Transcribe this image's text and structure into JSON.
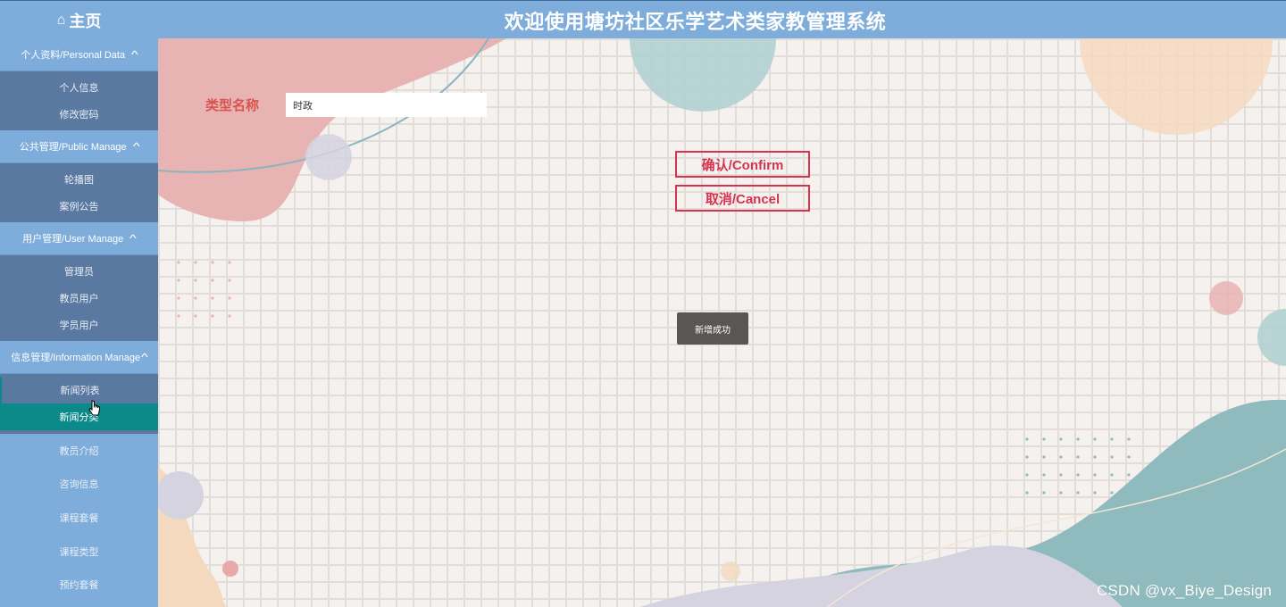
{
  "header": {
    "home_icon": "home-icon",
    "home_label": "主页",
    "title": "欢迎使用塘坊社区乐学艺术类家教管理系统"
  },
  "sidebar": {
    "groups": [
      {
        "label": "个人资料/Personal Data",
        "items": [
          "个人信息",
          "修改密码"
        ]
      },
      {
        "label": "公共管理/Public Manage",
        "items": [
          "轮播图",
          "案例公告"
        ]
      },
      {
        "label": "用户管理/User Manage",
        "items": [
          "管理员",
          "教员用户",
          "学员用户"
        ]
      },
      {
        "label": "信息管理/Information Manage",
        "items": [
          "新闻列表",
          "新闻分类"
        ]
      }
    ],
    "active_item": "新闻分类",
    "hovered_item": "新闻列表",
    "plain_items": [
      "教员介绍",
      "咨询信息",
      "课程套餐",
      "课程类型",
      "预约套餐"
    ]
  },
  "form": {
    "type_name_label": "类型名称",
    "type_name_value": "时政",
    "confirm_label": "确认/Confirm",
    "cancel_label": "取消/Cancel"
  },
  "toast": {
    "message": "新增成功"
  },
  "watermark": "CSDN @vx_Biye_Design",
  "colors": {
    "header_bg": "#7eaddb",
    "submenu_bg": "#5a79a0",
    "active_item_bg": "#0c8a8a",
    "accent_red": "#d6334f",
    "label_red": "#d9534f"
  }
}
